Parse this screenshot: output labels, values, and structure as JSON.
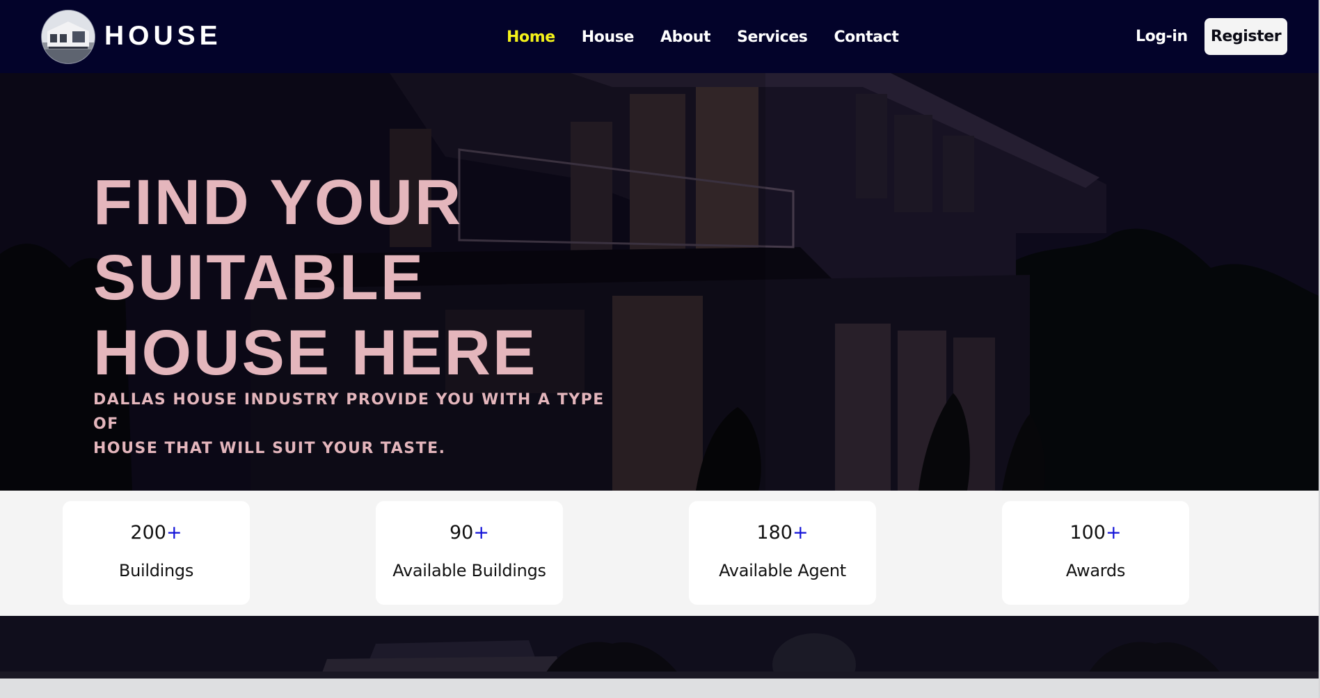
{
  "brand": {
    "name": "HOUSE",
    "logo_icon": "house-photo-logo"
  },
  "nav": {
    "links": [
      {
        "label": "Home",
        "active": true
      },
      {
        "label": "House",
        "active": false
      },
      {
        "label": "About",
        "active": false
      },
      {
        "label": "Services",
        "active": false
      },
      {
        "label": "Contact",
        "active": false
      }
    ],
    "login_label": "Log-in",
    "register_label": "Register"
  },
  "hero": {
    "title_lines": [
      "FIND YOUR",
      "SUITABLE",
      "HOUSE HERE"
    ],
    "subtitle_lines": [
      "DALLAS HOUSE INDUSTRY PROVIDE YOU WITH A TYPE OF",
      "HOUSE THAT WILL SUIT YOUR TASTE."
    ]
  },
  "stats": [
    {
      "value": "200",
      "plus": "+",
      "label": "Buildings"
    },
    {
      "value": "90",
      "plus": "+",
      "label": "Available Buildings"
    },
    {
      "value": "180",
      "plus": "+",
      "label": "Available Agent"
    },
    {
      "value": "100",
      "plus": "+",
      "label": "Awards"
    }
  ],
  "colors": {
    "navbar_bg": "#03032a",
    "active_link": "#f4f21a",
    "hero_text": "#e4b6bc",
    "plus_accent": "#1212d8",
    "stats_bg": "#f4f4f4"
  }
}
